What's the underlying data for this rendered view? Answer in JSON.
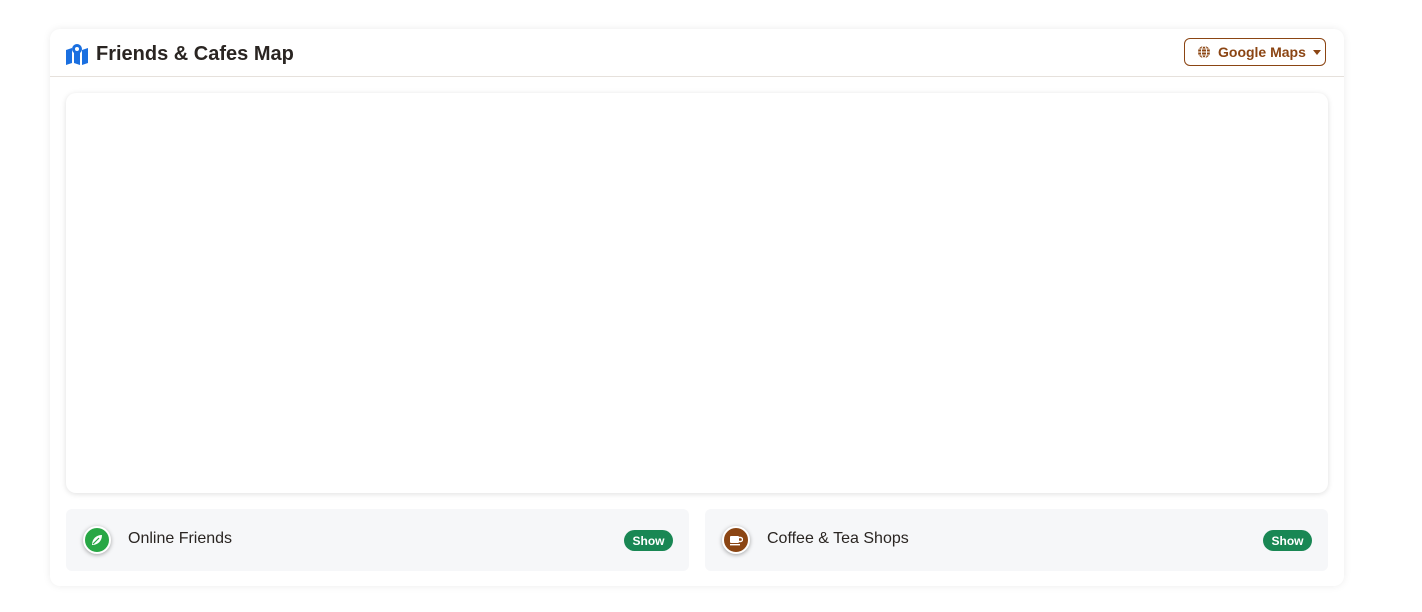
{
  "header": {
    "title": "Friends & Cafes Map",
    "title_icon": "map-icon",
    "map_provider": {
      "label": "Google Maps",
      "icon": "globe-icon"
    }
  },
  "panels": [
    {
      "label": "Online Friends",
      "icon": "leaf-icon",
      "color": "#28a745",
      "button_label": "Show"
    },
    {
      "label": "Coffee & Tea Shops",
      "icon": "coffee-cup-icon",
      "color": "#8b4513",
      "button_label": "Show"
    }
  ],
  "colors": {
    "accent": "#8b4513",
    "title_icon": "#1a6fe0",
    "show_button": "#198754"
  }
}
